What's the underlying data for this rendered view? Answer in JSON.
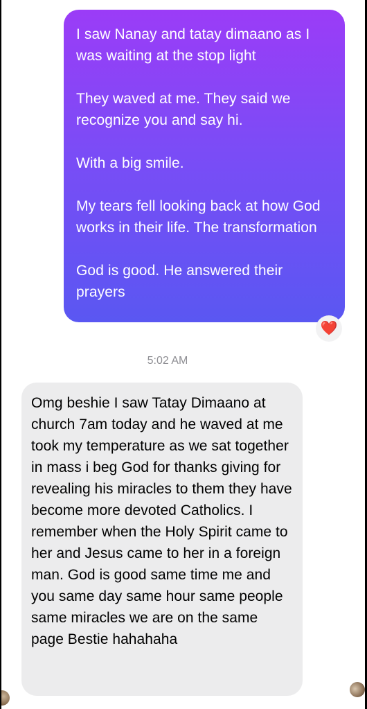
{
  "outgoing_message": {
    "paragraphs": [
      "I saw Nanay and tatay dimaano as I was waiting at the stop light",
      "They waved at me.  They said we recognize you and say hi.",
      "With a big smile.",
      "My tears fell looking back at how God works in their life. The transformation",
      "God is good. He answered their prayers"
    ],
    "reaction": "❤️"
  },
  "timestamp": "5:02 AM",
  "incoming_message": {
    "text": "Omg beshie I saw Tatay Dimaano at church 7am today and he waved at me took my temperature as we sat together in mass i beg God for thanks giving for revealing his miracles to them they have become more devoted Catholics. I remember when the Holy Spirit came to her and Jesus came to her in a foreign man. God is good same time me and you same day same hour same people same miracles we are on the same page Bestie hahahaha"
  },
  "colors": {
    "outgoing_gradient_top": "#9b3cf7",
    "outgoing_gradient_bottom": "#5a57f2",
    "incoming_bubble": "#ececed",
    "timestamp": "#8e8e93",
    "heart": "#e8202e"
  },
  "icons": {
    "reaction": "heart-icon"
  }
}
